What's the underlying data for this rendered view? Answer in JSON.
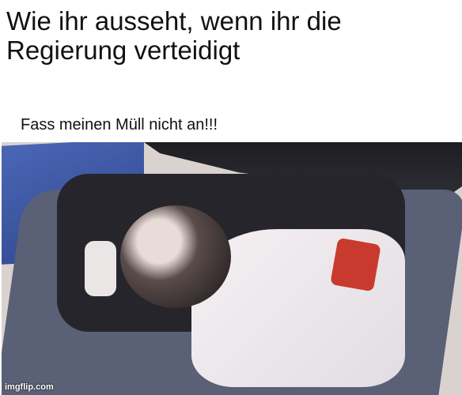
{
  "meme": {
    "top_text_line1": "Wie ihr ausseht, wenn ihr die",
    "top_text_line2": "Regierung verteidigt",
    "caption": "Fass meinen Müll nicht an!!!",
    "watermark": "imgflip.com"
  }
}
